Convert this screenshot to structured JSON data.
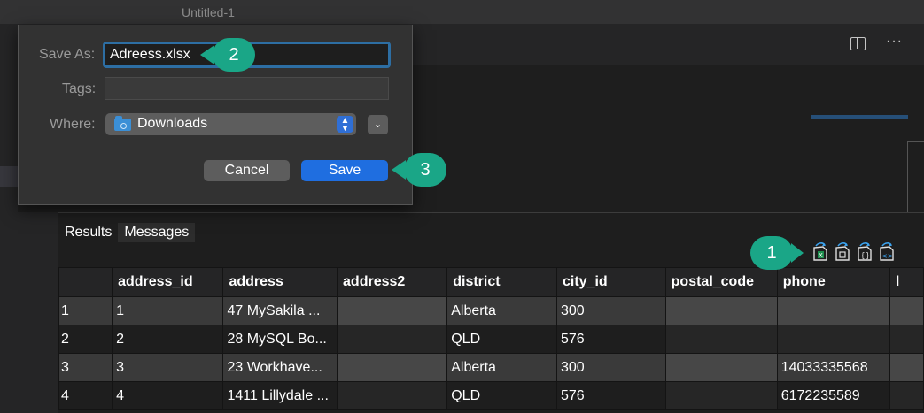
{
  "window": {
    "title": "Untitled-1"
  },
  "save_dialog": {
    "save_as_label": "Save As:",
    "filename": "Adreess.xlsx",
    "tags_label": "Tags:",
    "tags_value": "",
    "where_label": "Where:",
    "where_value": "Downloads",
    "cancel_label": "Cancel",
    "save_label": "Save"
  },
  "panel": {
    "tabs": [
      {
        "label": "Results"
      },
      {
        "label": "Messages"
      }
    ],
    "export_icons": [
      "save-as-excel-icon",
      "save-as-csv-icon",
      "save-as-json-icon",
      "save-as-xml-icon"
    ]
  },
  "table": {
    "columns": [
      "",
      "address_id",
      "address",
      "address2",
      "district",
      "city_id",
      "postal_code",
      "phone",
      "l"
    ],
    "rows": [
      [
        "1",
        "1",
        "47 MySakila ...",
        "",
        "Alberta",
        "300",
        "",
        ""
      ],
      [
        "2",
        "2",
        "28 MySQL Bo...",
        "",
        "QLD",
        "576",
        "",
        ""
      ],
      [
        "3",
        "3",
        "23 Workhave...",
        "",
        "Alberta",
        "300",
        "",
        "14033335568"
      ],
      [
        "4",
        "4",
        "1411 Lillydale ...",
        "",
        "QLD",
        "576",
        "",
        "6172235589"
      ]
    ]
  },
  "callouts": {
    "one": "1",
    "two": "2",
    "three": "3"
  },
  "colors": {
    "accent": "#1aa687",
    "save_button": "#1f6ee0",
    "focus_ring": "#2d6ea3"
  }
}
